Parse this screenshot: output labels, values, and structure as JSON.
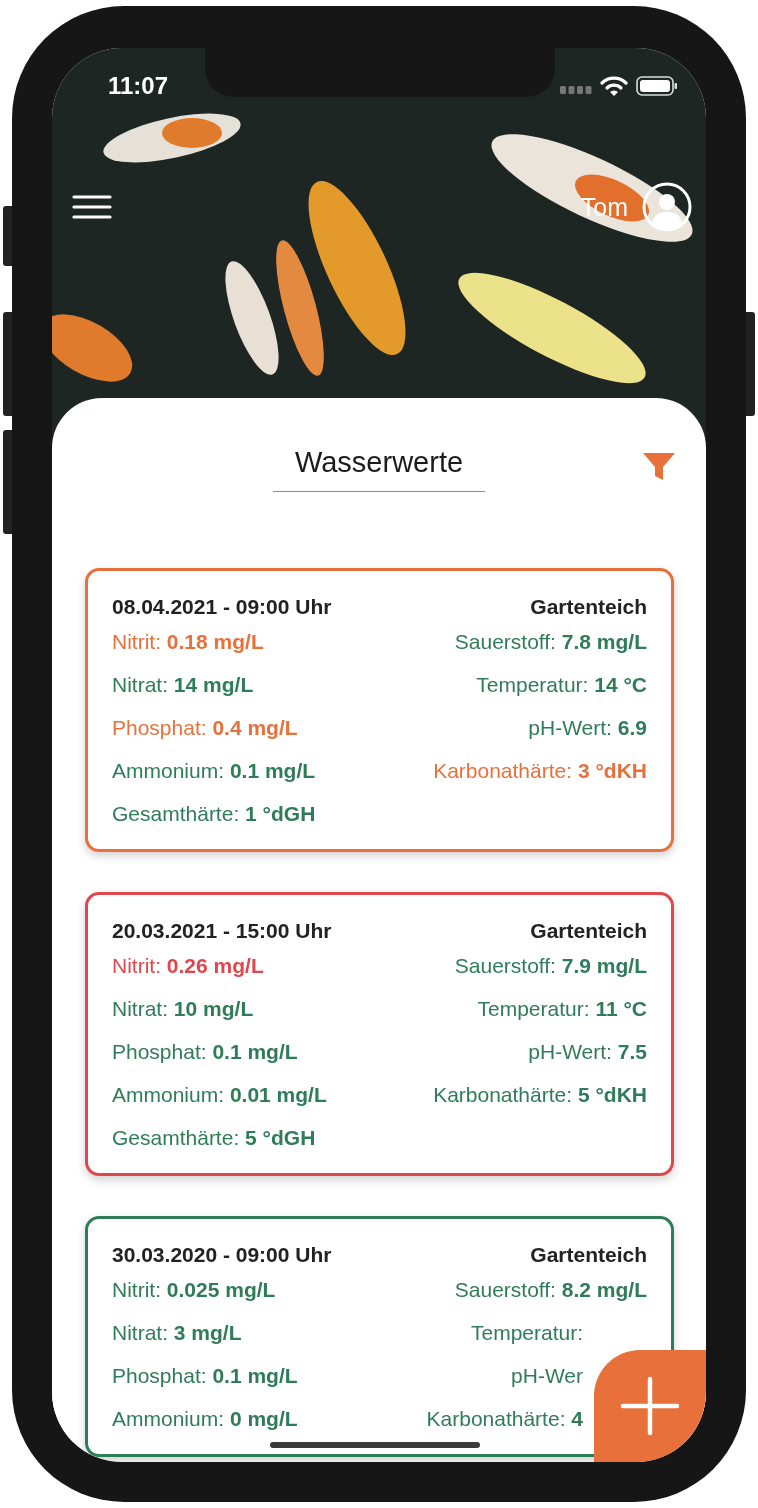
{
  "status_bar": {
    "time": "11:07"
  },
  "header": {
    "user_name": "Tom"
  },
  "title": "Wasserwerte",
  "cards": [
    {
      "date": "08.04.2021 - 09:00 Uhr",
      "pond": "Gartenteich",
      "color": "#e8703a",
      "params": [
        {
          "label": "Nitrit:",
          "value": "0.18 mg/L",
          "color": "#e8703a"
        },
        {
          "label": "Sauerstoff:",
          "value": "7.8 mg/L",
          "color": "#2f7d58"
        },
        {
          "label": "Nitrat:",
          "value": "14 mg/L",
          "color": "#2f7d58"
        },
        {
          "label": "Temperatur:",
          "value": "14 °C",
          "color": "#2f7d58"
        },
        {
          "label": "Phosphat:",
          "value": "0.4 mg/L",
          "color": "#e8703a"
        },
        {
          "label": "pH-Wert:",
          "value": "6.9",
          "color": "#2f7d58"
        },
        {
          "label": "Ammonium:",
          "value": "0.1 mg/L",
          "color": "#2f7d58"
        },
        {
          "label": "Karbonathärte:",
          "value": "3 °dKH",
          "color": "#e8703a"
        },
        {
          "label": "Gesamthärte:",
          "value": "1 °dGH",
          "color": "#2f7d58"
        }
      ]
    },
    {
      "date": "20.03.2021 - 15:00 Uhr",
      "pond": "Gartenteich",
      "color": "#e0474c",
      "params": [
        {
          "label": "Nitrit:",
          "value": "0.26 mg/L",
          "color": "#e0474c"
        },
        {
          "label": "Sauerstoff:",
          "value": "7.9 mg/L",
          "color": "#2f7d58"
        },
        {
          "label": "Nitrat:",
          "value": "10 mg/L",
          "color": "#2f7d58"
        },
        {
          "label": "Temperatur:",
          "value": "11 °C",
          "color": "#2f7d58"
        },
        {
          "label": "Phosphat:",
          "value": "0.1 mg/L",
          "color": "#2f7d58"
        },
        {
          "label": "pH-Wert:",
          "value": "7.5",
          "color": "#2f7d58"
        },
        {
          "label": "Ammonium:",
          "value": "0.01 mg/L",
          "color": "#2f7d58"
        },
        {
          "label": "Karbonathärte:",
          "value": "5 °dKH",
          "color": "#2f7d58"
        },
        {
          "label": "Gesamthärte:",
          "value": "5 °dGH",
          "color": "#2f7d58"
        }
      ]
    },
    {
      "date": "30.03.2020 - 09:00 Uhr",
      "pond": "Gartenteich",
      "color": "#2f7d58",
      "params": [
        {
          "label": "Nitrit:",
          "value": "0.025 mg/L",
          "color": "#2f7d58"
        },
        {
          "label": "Sauerstoff:",
          "value": "8.2 mg/L",
          "color": "#2f7d58"
        },
        {
          "label": "Nitrat:",
          "value": "3 mg/L",
          "color": "#2f7d58"
        },
        {
          "label": "Temperatur:",
          "color": "#2f7d58",
          "cut": true
        },
        {
          "label": "Phosphat:",
          "value": "0.1 mg/L",
          "color": "#2f7d58"
        },
        {
          "label": "pH-Wer",
          "color": "#2f7d58",
          "cut": true
        },
        {
          "label": "Ammonium:",
          "value": "0 mg/L",
          "color": "#2f7d58"
        },
        {
          "label": "Karbonathärte:",
          "value": "4",
          "color": "#2f7d58",
          "cut": true
        }
      ]
    }
  ]
}
